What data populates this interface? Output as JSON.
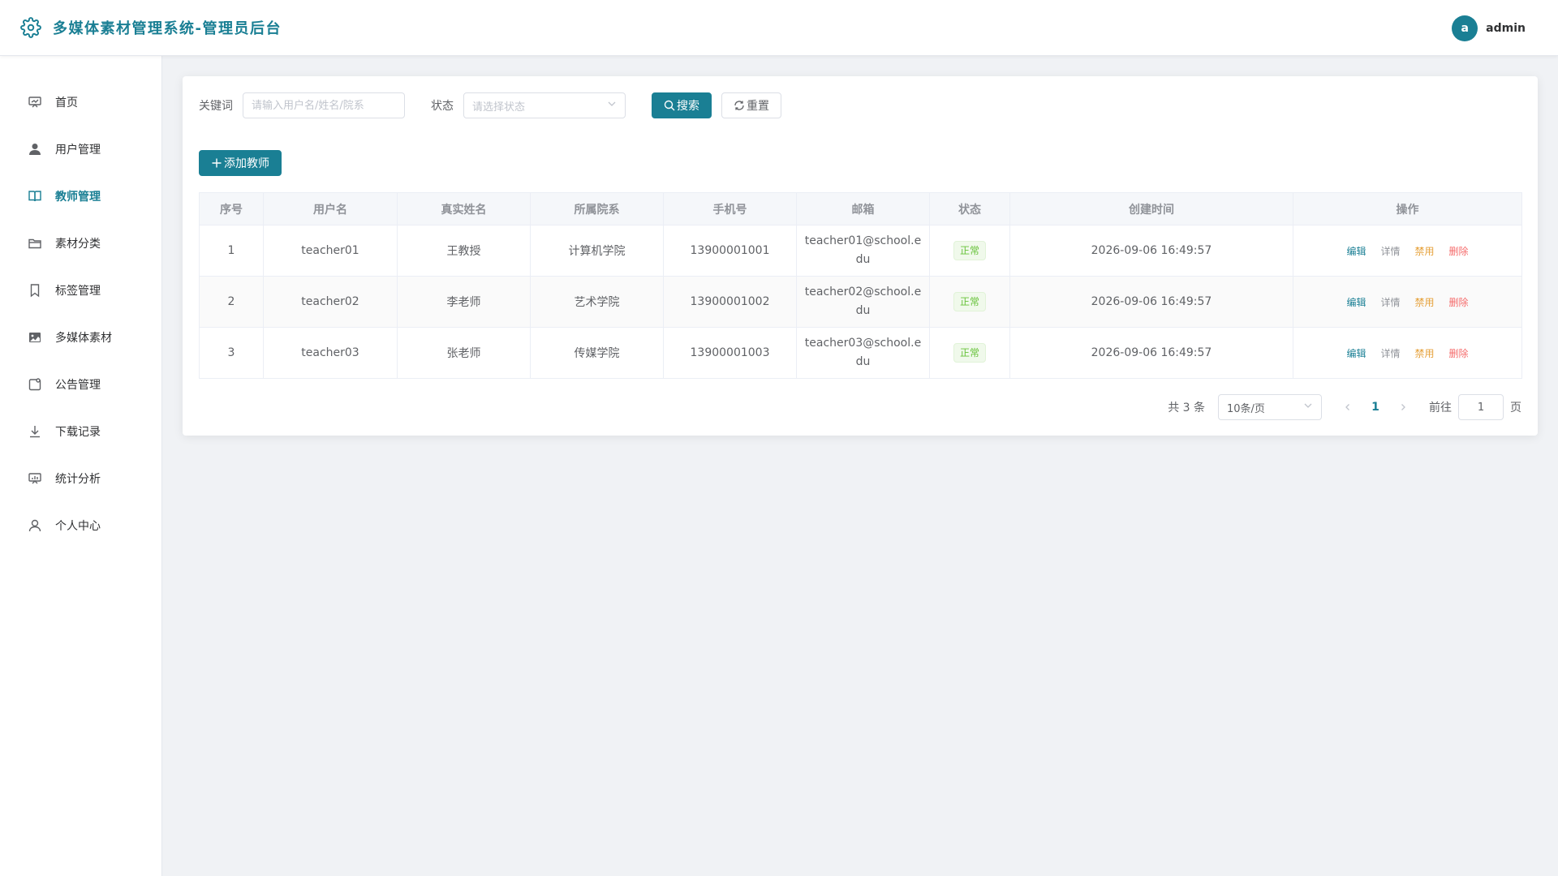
{
  "header": {
    "title": "多媒体素材管理系统-管理员后台",
    "avatar_letter": "a",
    "username": "admin",
    "icon": "gear-icon"
  },
  "sidebar": {
    "items": [
      {
        "label": "首页",
        "icon": "dashboard-icon",
        "active": false
      },
      {
        "label": "用户管理",
        "icon": "user-icon",
        "active": false
      },
      {
        "label": "教师管理",
        "icon": "book-icon",
        "active": true
      },
      {
        "label": "素材分类",
        "icon": "folder-icon",
        "active": false
      },
      {
        "label": "标签管理",
        "icon": "bookmark-icon",
        "active": false
      },
      {
        "label": "多媒体素材",
        "icon": "picture-icon",
        "active": false
      },
      {
        "label": "公告管理",
        "icon": "notice-icon",
        "active": false
      },
      {
        "label": "下载记录",
        "icon": "download-icon",
        "active": false
      },
      {
        "label": "统计分析",
        "icon": "chart-icon",
        "active": false
      },
      {
        "label": "个人中心",
        "icon": "person-icon",
        "active": false
      }
    ]
  },
  "filter": {
    "keyword_label": "关键词",
    "keyword_placeholder": "请输入用户名/姓名/院系",
    "status_label": "状态",
    "status_placeholder": "请选择状态",
    "search_label": "搜索",
    "reset_label": "重置"
  },
  "toolbar": {
    "add_label": "添加教师"
  },
  "table": {
    "columns": [
      "序号",
      "用户名",
      "真实姓名",
      "所属院系",
      "手机号",
      "邮箱",
      "状态",
      "创建时间",
      "操作"
    ],
    "rows": [
      {
        "index": "1",
        "username": "teacher01",
        "name": "王教授",
        "dept": "计算机学院",
        "phone": "13900001001",
        "email": "teacher01@school.edu",
        "status": "正常",
        "created": "2026-09-06 16:49:57"
      },
      {
        "index": "2",
        "username": "teacher02",
        "name": "李老师",
        "dept": "艺术学院",
        "phone": "13900001002",
        "email": "teacher02@school.edu",
        "status": "正常",
        "created": "2026-09-06 16:49:57"
      },
      {
        "index": "3",
        "username": "teacher03",
        "name": "张老师",
        "dept": "传媒学院",
        "phone": "13900001003",
        "email": "teacher03@school.edu",
        "status": "正常",
        "created": "2026-09-06 16:49:57"
      }
    ],
    "actions": {
      "edit": "编辑",
      "detail": "详情",
      "disable": "禁用",
      "delete": "删除"
    }
  },
  "pagination": {
    "total_text": "共 3 条",
    "page_size": "10条/页",
    "current_page": "1",
    "goto_label": "前往",
    "goto_value": "1",
    "page_suffix": "页"
  },
  "colors": {
    "primary": "#1a7f94",
    "success": "#67c23a",
    "warning": "#e6a23c",
    "danger": "#f56c6c"
  }
}
